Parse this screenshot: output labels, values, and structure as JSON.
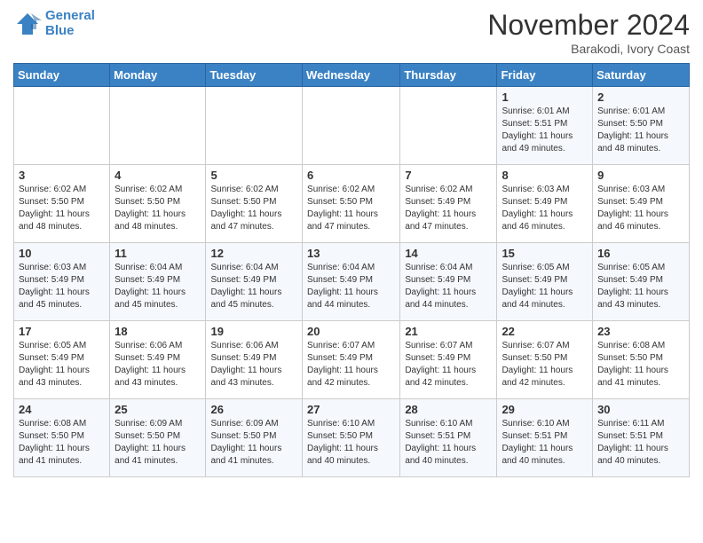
{
  "header": {
    "logo_line1": "General",
    "logo_line2": "Blue",
    "month": "November 2024",
    "location": "Barakodi, Ivory Coast"
  },
  "days_of_week": [
    "Sunday",
    "Monday",
    "Tuesday",
    "Wednesday",
    "Thursday",
    "Friday",
    "Saturday"
  ],
  "weeks": [
    [
      {
        "day": "",
        "info": ""
      },
      {
        "day": "",
        "info": ""
      },
      {
        "day": "",
        "info": ""
      },
      {
        "day": "",
        "info": ""
      },
      {
        "day": "",
        "info": ""
      },
      {
        "day": "1",
        "info": "Sunrise: 6:01 AM\nSunset: 5:51 PM\nDaylight: 11 hours\nand 49 minutes."
      },
      {
        "day": "2",
        "info": "Sunrise: 6:01 AM\nSunset: 5:50 PM\nDaylight: 11 hours\nand 48 minutes."
      }
    ],
    [
      {
        "day": "3",
        "info": "Sunrise: 6:02 AM\nSunset: 5:50 PM\nDaylight: 11 hours\nand 48 minutes."
      },
      {
        "day": "4",
        "info": "Sunrise: 6:02 AM\nSunset: 5:50 PM\nDaylight: 11 hours\nand 48 minutes."
      },
      {
        "day": "5",
        "info": "Sunrise: 6:02 AM\nSunset: 5:50 PM\nDaylight: 11 hours\nand 47 minutes."
      },
      {
        "day": "6",
        "info": "Sunrise: 6:02 AM\nSunset: 5:50 PM\nDaylight: 11 hours\nand 47 minutes."
      },
      {
        "day": "7",
        "info": "Sunrise: 6:02 AM\nSunset: 5:49 PM\nDaylight: 11 hours\nand 47 minutes."
      },
      {
        "day": "8",
        "info": "Sunrise: 6:03 AM\nSunset: 5:49 PM\nDaylight: 11 hours\nand 46 minutes."
      },
      {
        "day": "9",
        "info": "Sunrise: 6:03 AM\nSunset: 5:49 PM\nDaylight: 11 hours\nand 46 minutes."
      }
    ],
    [
      {
        "day": "10",
        "info": "Sunrise: 6:03 AM\nSunset: 5:49 PM\nDaylight: 11 hours\nand 45 minutes."
      },
      {
        "day": "11",
        "info": "Sunrise: 6:04 AM\nSunset: 5:49 PM\nDaylight: 11 hours\nand 45 minutes."
      },
      {
        "day": "12",
        "info": "Sunrise: 6:04 AM\nSunset: 5:49 PM\nDaylight: 11 hours\nand 45 minutes."
      },
      {
        "day": "13",
        "info": "Sunrise: 6:04 AM\nSunset: 5:49 PM\nDaylight: 11 hours\nand 44 minutes."
      },
      {
        "day": "14",
        "info": "Sunrise: 6:04 AM\nSunset: 5:49 PM\nDaylight: 11 hours\nand 44 minutes."
      },
      {
        "day": "15",
        "info": "Sunrise: 6:05 AM\nSunset: 5:49 PM\nDaylight: 11 hours\nand 44 minutes."
      },
      {
        "day": "16",
        "info": "Sunrise: 6:05 AM\nSunset: 5:49 PM\nDaylight: 11 hours\nand 43 minutes."
      }
    ],
    [
      {
        "day": "17",
        "info": "Sunrise: 6:05 AM\nSunset: 5:49 PM\nDaylight: 11 hours\nand 43 minutes."
      },
      {
        "day": "18",
        "info": "Sunrise: 6:06 AM\nSunset: 5:49 PM\nDaylight: 11 hours\nand 43 minutes."
      },
      {
        "day": "19",
        "info": "Sunrise: 6:06 AM\nSunset: 5:49 PM\nDaylight: 11 hours\nand 43 minutes."
      },
      {
        "day": "20",
        "info": "Sunrise: 6:07 AM\nSunset: 5:49 PM\nDaylight: 11 hours\nand 42 minutes."
      },
      {
        "day": "21",
        "info": "Sunrise: 6:07 AM\nSunset: 5:49 PM\nDaylight: 11 hours\nand 42 minutes."
      },
      {
        "day": "22",
        "info": "Sunrise: 6:07 AM\nSunset: 5:50 PM\nDaylight: 11 hours\nand 42 minutes."
      },
      {
        "day": "23",
        "info": "Sunrise: 6:08 AM\nSunset: 5:50 PM\nDaylight: 11 hours\nand 41 minutes."
      }
    ],
    [
      {
        "day": "24",
        "info": "Sunrise: 6:08 AM\nSunset: 5:50 PM\nDaylight: 11 hours\nand 41 minutes."
      },
      {
        "day": "25",
        "info": "Sunrise: 6:09 AM\nSunset: 5:50 PM\nDaylight: 11 hours\nand 41 minutes."
      },
      {
        "day": "26",
        "info": "Sunrise: 6:09 AM\nSunset: 5:50 PM\nDaylight: 11 hours\nand 41 minutes."
      },
      {
        "day": "27",
        "info": "Sunrise: 6:10 AM\nSunset: 5:50 PM\nDaylight: 11 hours\nand 40 minutes."
      },
      {
        "day": "28",
        "info": "Sunrise: 6:10 AM\nSunset: 5:51 PM\nDaylight: 11 hours\nand 40 minutes."
      },
      {
        "day": "29",
        "info": "Sunrise: 6:10 AM\nSunset: 5:51 PM\nDaylight: 11 hours\nand 40 minutes."
      },
      {
        "day": "30",
        "info": "Sunrise: 6:11 AM\nSunset: 5:51 PM\nDaylight: 11 hours\nand 40 minutes."
      }
    ]
  ]
}
